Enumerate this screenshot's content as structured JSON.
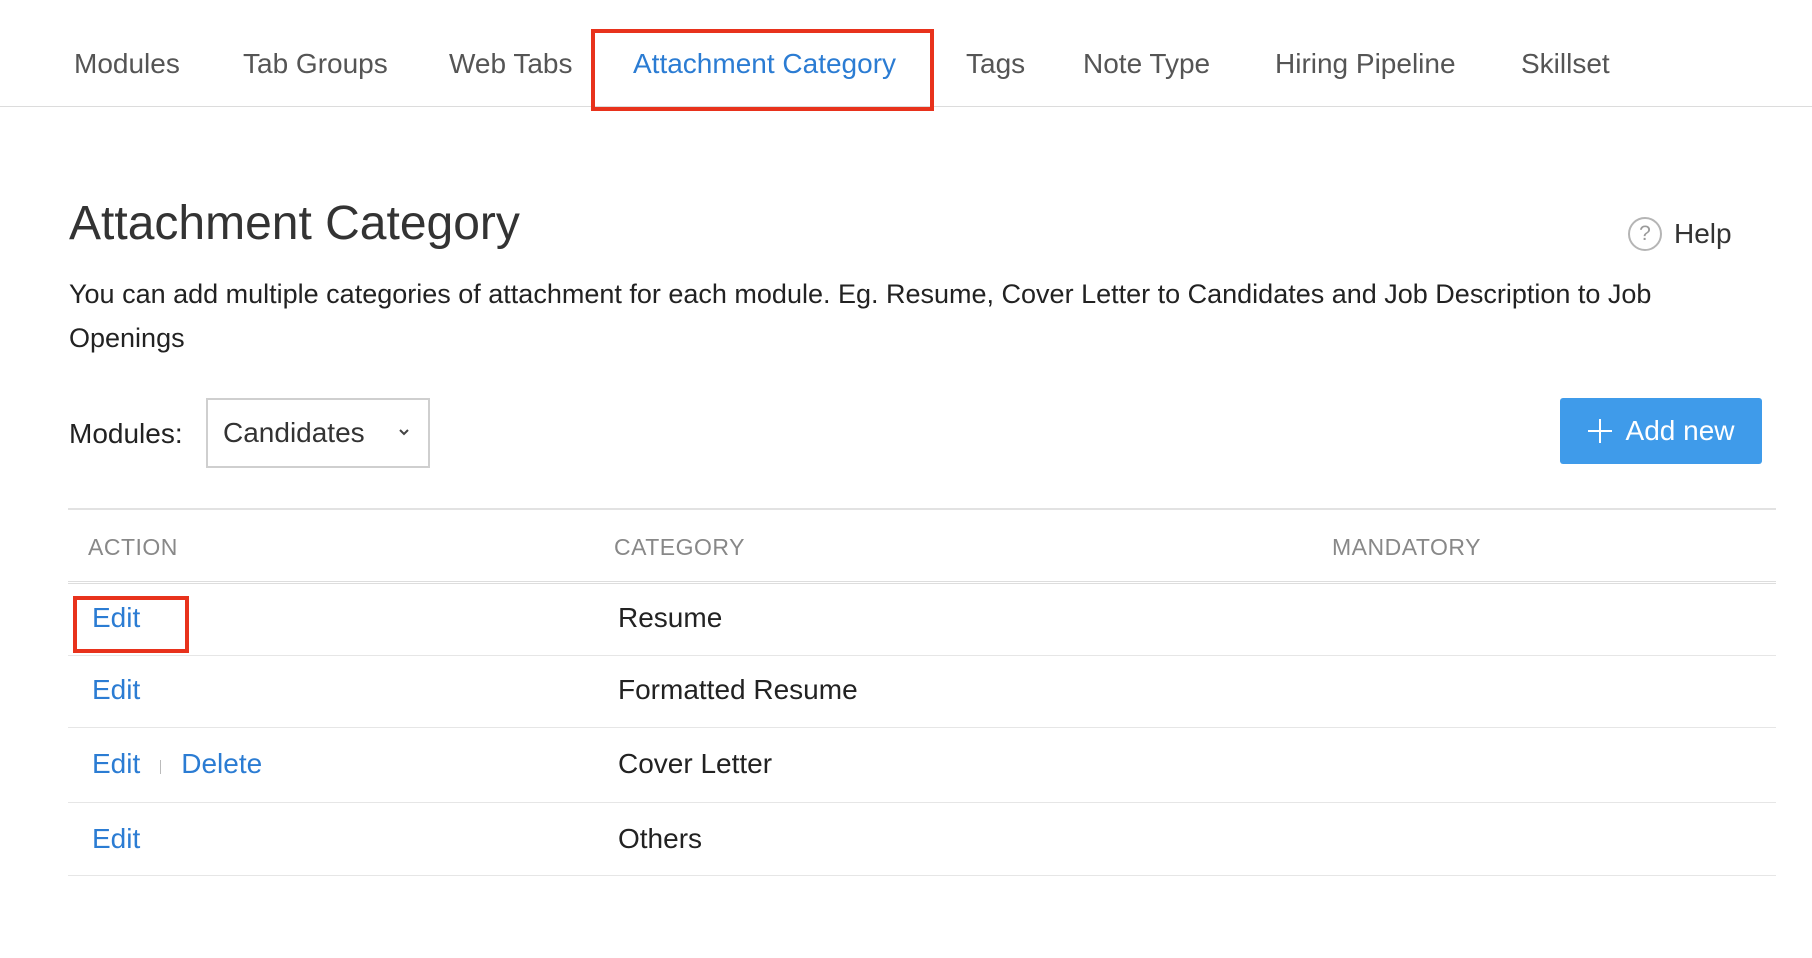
{
  "tabs": [
    {
      "label": "Modules"
    },
    {
      "label": "Tab Groups"
    },
    {
      "label": "Web Tabs"
    },
    {
      "label": "Attachment Category",
      "active": true
    },
    {
      "label": "Tags"
    },
    {
      "label": "Note Type"
    },
    {
      "label": "Hiring Pipeline"
    },
    {
      "label": "Skillset"
    }
  ],
  "page": {
    "title": "Attachment Category",
    "help_label": "Help",
    "help_icon": "question-circle-icon",
    "description": "You can add multiple categories of attachment for each module. Eg. Resume, Cover Letter to Candidates and Job Description to Job Openings"
  },
  "filter": {
    "label": "Modules:",
    "selected": "Candidates"
  },
  "add_button": {
    "label": "Add new",
    "icon": "plus-icon"
  },
  "table": {
    "columns": [
      "ACTION",
      "CATEGORY",
      "MANDATORY"
    ],
    "rows": [
      {
        "actions": [
          "Edit"
        ],
        "category": "Resume",
        "mandatory": ""
      },
      {
        "actions": [
          "Edit"
        ],
        "category": "Formatted Resume",
        "mandatory": ""
      },
      {
        "actions": [
          "Edit",
          "Delete"
        ],
        "category": "Cover Letter",
        "mandatory": ""
      },
      {
        "actions": [
          "Edit"
        ],
        "category": "Others",
        "mandatory": ""
      }
    ]
  },
  "colors": {
    "accent": "#2b7cd3",
    "button": "#3f9bea",
    "highlight": "#e8321c"
  }
}
